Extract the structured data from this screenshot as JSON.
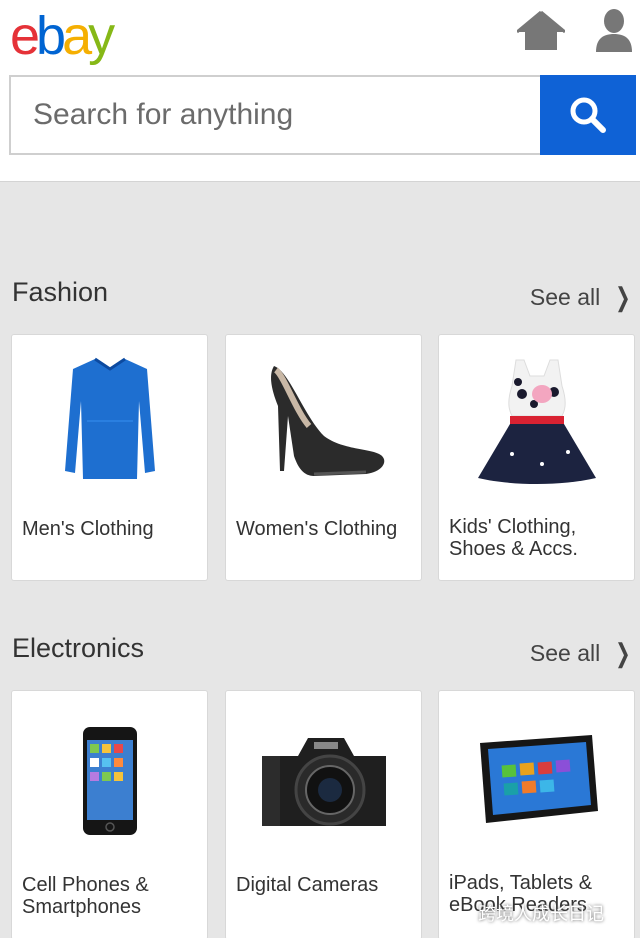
{
  "header": {
    "logo_letters": [
      "e",
      "b",
      "a",
      "y"
    ],
    "logo_colors": [
      "#e53238",
      "#0064d2",
      "#f5af02",
      "#86b817"
    ],
    "home_icon": "home-icon",
    "user_icon": "user-icon"
  },
  "search": {
    "placeholder": "Search for anything",
    "button_icon": "search-icon",
    "accent": "#0f62d6"
  },
  "sections": [
    {
      "title": "Fashion",
      "see_all": "See all",
      "cards": [
        {
          "label": "Men's Clothing",
          "icon": "sweater-image"
        },
        {
          "label": "Women's Clothing",
          "icon": "high-heel-shoe-image"
        },
        {
          "label": "Kids' Clothing, Shoes & Accs.",
          "icon": "kids-dress-image"
        }
      ]
    },
    {
      "title": "Electronics",
      "see_all": "See all",
      "cards": [
        {
          "label": "Cell Phones & Smartphones",
          "icon": "smartphone-image"
        },
        {
          "label": "Digital Cameras",
          "icon": "camera-image"
        },
        {
          "label": "iPads, Tablets & eBook Readers",
          "icon": "tablet-image"
        }
      ]
    }
  ],
  "watermark": "跨境人成长日记"
}
